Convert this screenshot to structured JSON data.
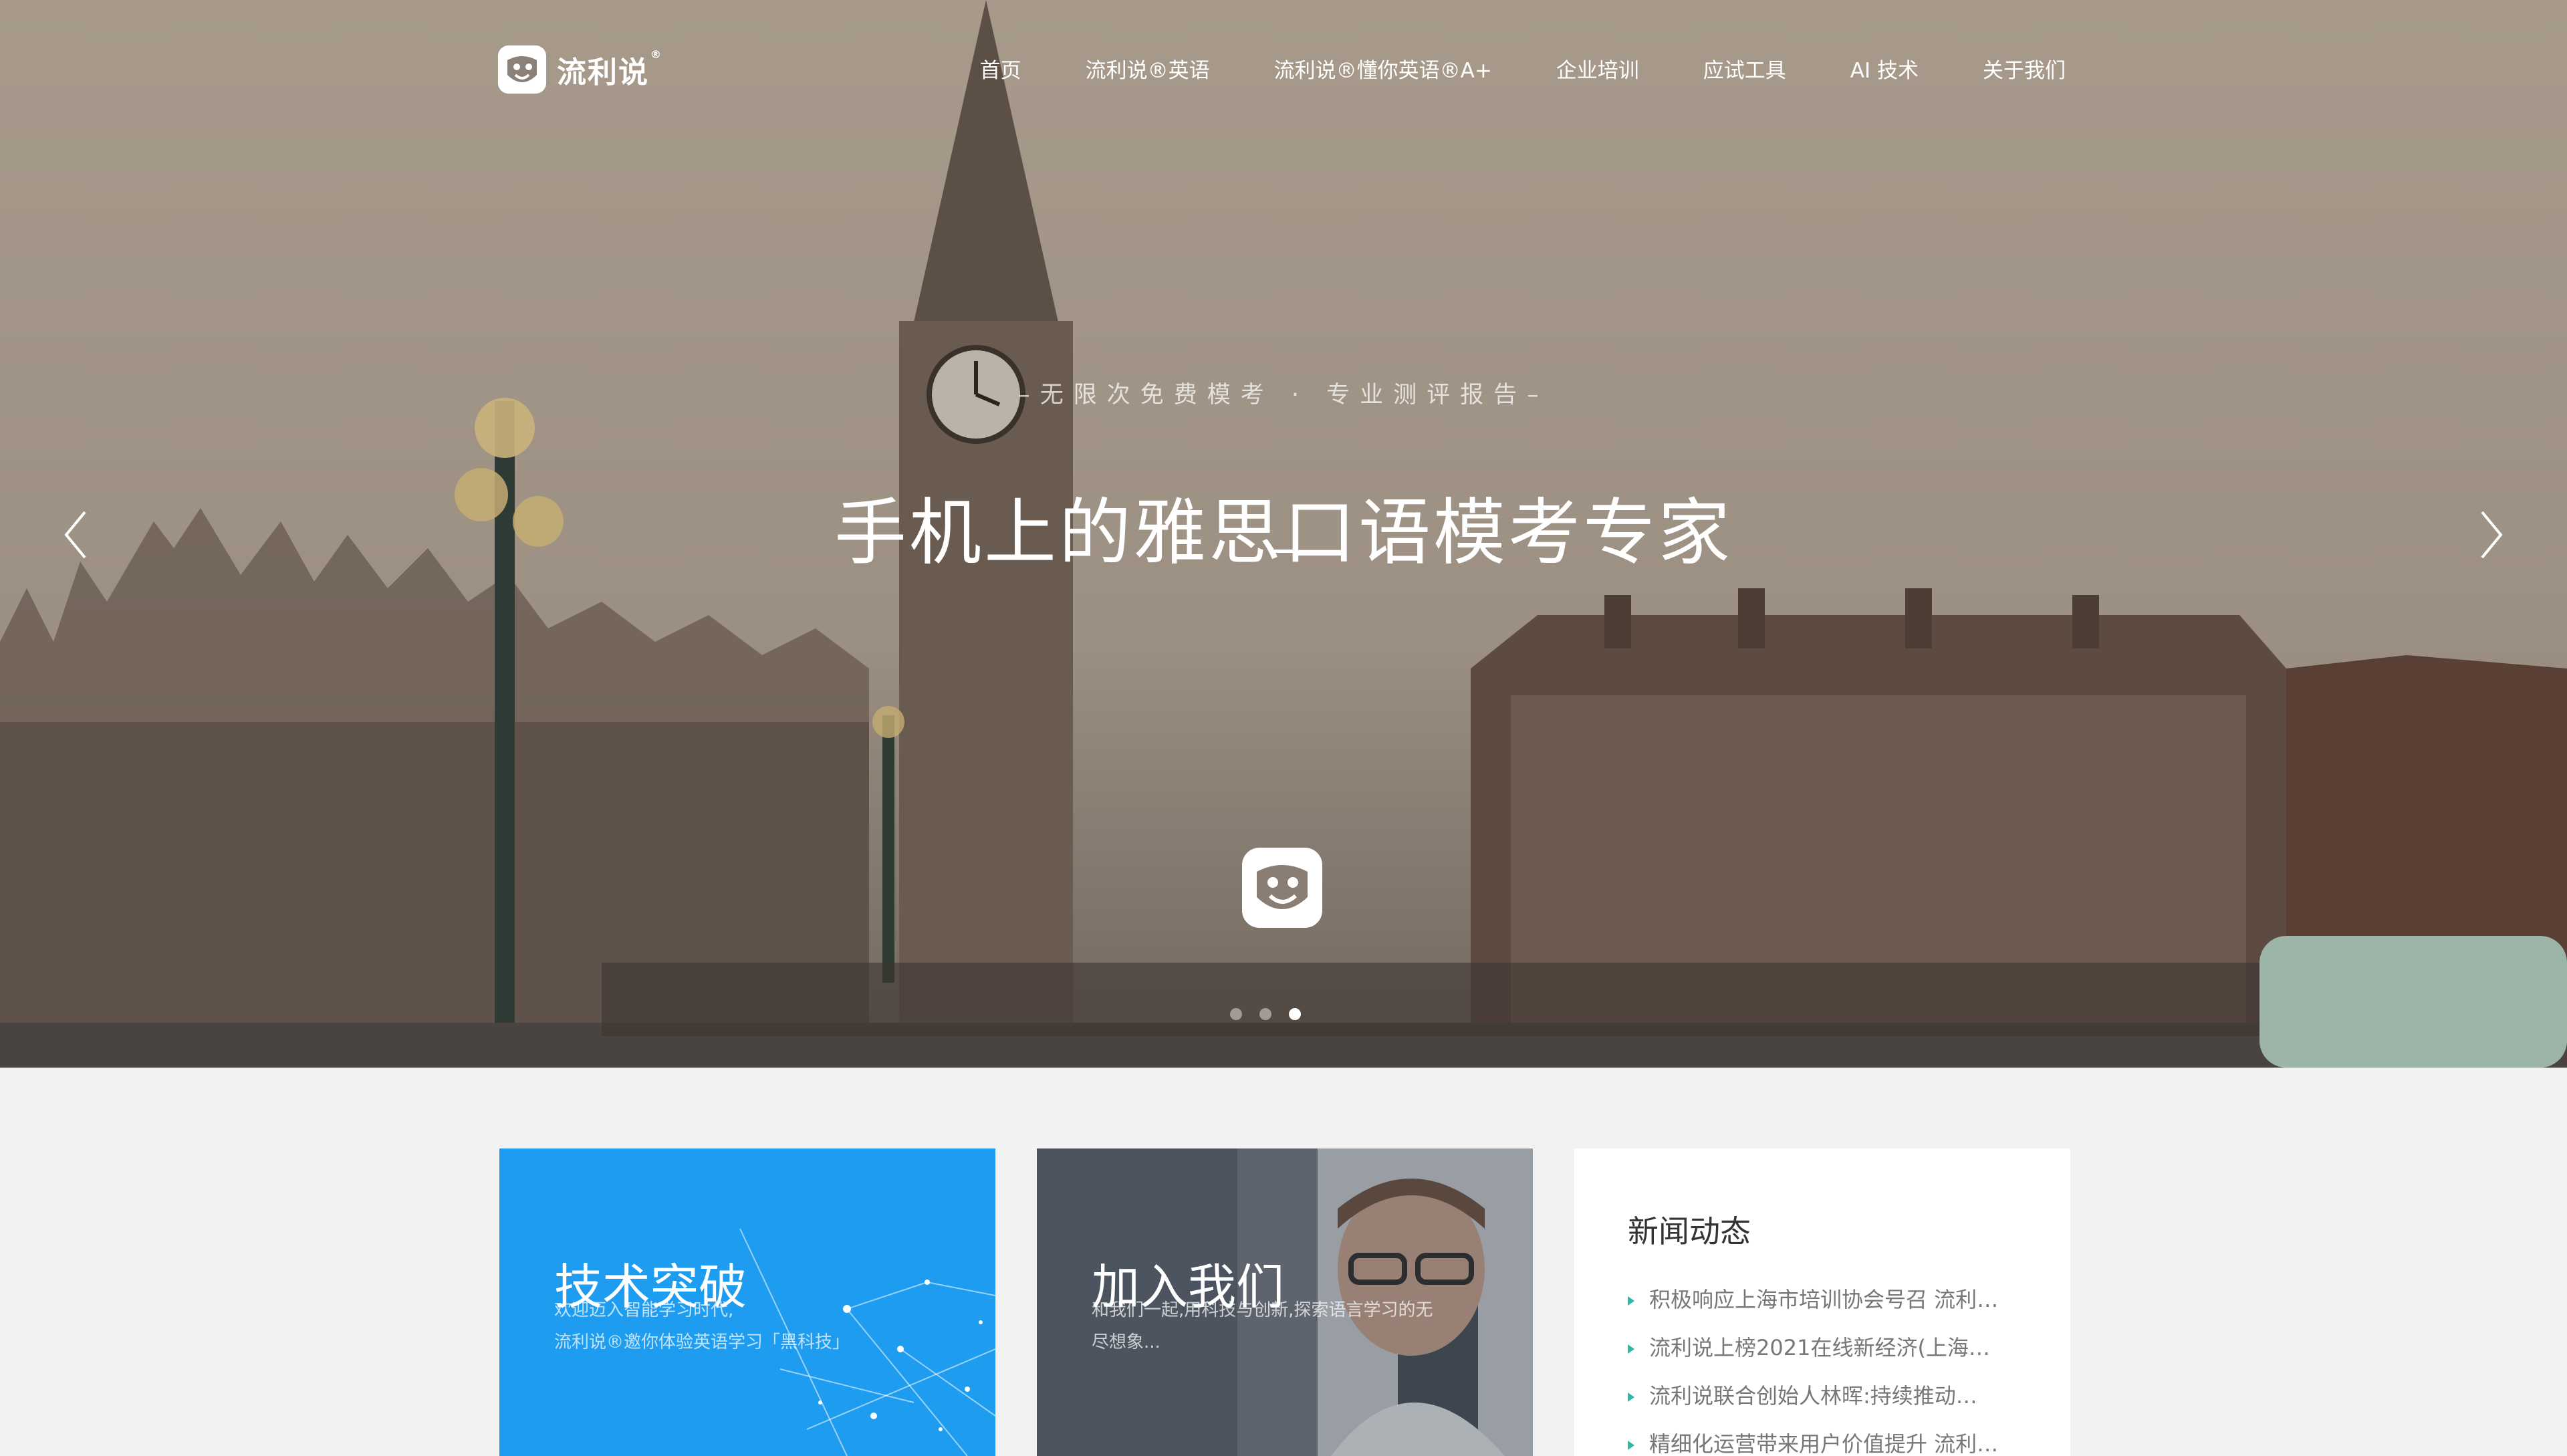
{
  "brand": {
    "name": "流利说",
    "reg_mark": "®"
  },
  "nav": {
    "items": [
      {
        "label": "首页"
      },
      {
        "label": "流利说®英语"
      },
      {
        "label": "流利说®懂你英语®A+"
      },
      {
        "label": "企业培训"
      },
      {
        "label": "应试工具"
      },
      {
        "label": "AI 技术"
      },
      {
        "label": "关于我们"
      }
    ]
  },
  "hero": {
    "subtitle": "–无限次免费模考 · 专业测评报告–",
    "title": "手机上的雅思口语模考专家",
    "prev_icon": "chevron-left-icon",
    "next_icon": "chevron-right-icon",
    "slide_count": 3,
    "active_slide": 3
  },
  "cards": {
    "tech": {
      "title": "技术突破",
      "desc_line1": "欢迎迈入智能学习时代,",
      "desc_line2": "流利说®邀你体验英语学习「黑科技」"
    },
    "join": {
      "title": "加入我们",
      "desc": "和我们一起,用科技与创新,探索语言学习的无尽想象..."
    },
    "news": {
      "title": "新闻动态",
      "items": [
        {
          "text": "积极响应上海市培训协会号召 流利说…"
        },
        {
          "text": "流利说上榜2021在线新经济(上海…"
        },
        {
          "text": "流利说联合创始人林晖:持续推动…"
        },
        {
          "text": "精细化运营带来用户价值提升 流利…"
        }
      ]
    }
  },
  "colors": {
    "accent_blue": "#1e9cf0",
    "news_bullet": "#2cb9a5",
    "page_bg": "#f2f2f2"
  }
}
